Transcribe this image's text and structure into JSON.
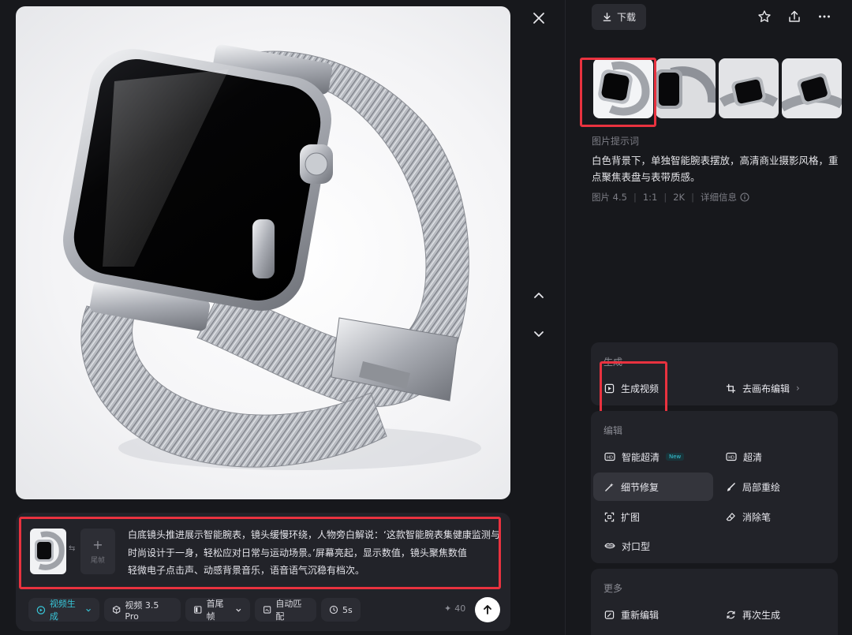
{
  "toolbar": {
    "download_label": "下载"
  },
  "viewer": {
    "close_icon": "close-icon",
    "prev_icon": "chevron-up-icon",
    "next_icon": "chevron-down-icon"
  },
  "info": {
    "prompt_heading": "图片提示词",
    "prompt_text": "白色背景下，单独智能腕表摆放，高清商业摄影风格，重点聚焦表盘与表带质感。",
    "meta": {
      "model": "图片 4.5",
      "ratio": "1:1",
      "resolution": "2K",
      "detail_label": "详细信息"
    }
  },
  "generate_section": {
    "title": "生成",
    "generate_video": "生成视频",
    "canvas_edit": "去画布编辑"
  },
  "edit_section": {
    "title": "编辑",
    "smart_hd": "智能超清",
    "new_badge": "New",
    "super_hd": "超清",
    "detail_fix": "细节修复",
    "local_redraw": "局部重绘",
    "expand": "扩图",
    "eraser": "消除笔",
    "lip_sync": "对口型"
  },
  "more_section": {
    "title": "更多",
    "re_edit": "重新编辑",
    "regenerate": "再次生成"
  },
  "composer": {
    "text_line1": "白底镜头推进展示智能腕表，镜头缓慢环绕，人物旁白解说：‘这款智能腕表集健康监测与",
    "text_line2": "时尚设计于一身，轻松应对日常与运动场景。’屏幕亮起，显示数值，镜头聚焦数值",
    "text_line3": "轻微电子点击声、动感背景音乐，语音语气沉稳有档次。",
    "end_frame_label": "尾帧",
    "mode": "视频生成",
    "model": "视频 3.5 Pro",
    "frames": "首尾帧",
    "ratio": "自动匹配",
    "duration": "5s",
    "credits": "40"
  },
  "colors": {
    "highlight": "#e9323f",
    "accent": "#38c6d8",
    "background": "#17181c",
    "panel": "#222329"
  }
}
